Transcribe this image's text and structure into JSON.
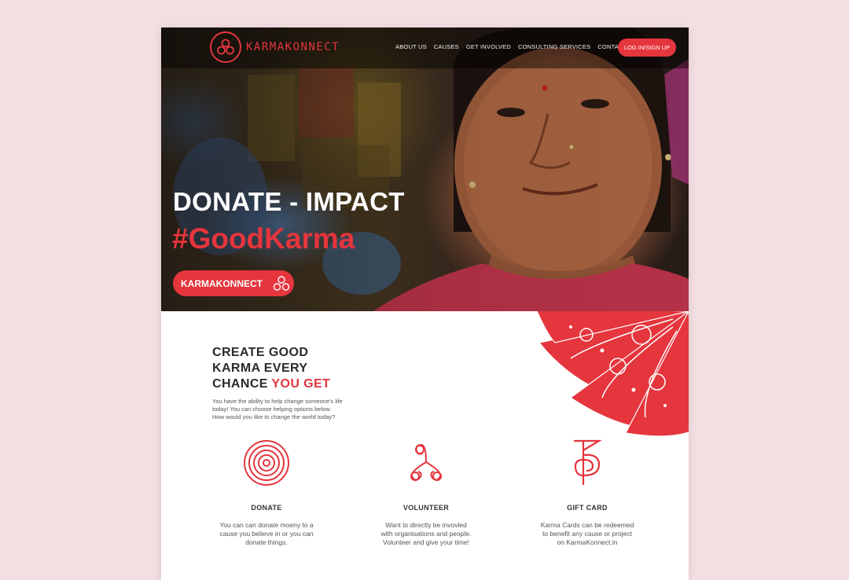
{
  "brand": {
    "name": "KARMAKONNECT",
    "accent": "#e5353d"
  },
  "nav": {
    "items": [
      "ABOUT US",
      "CAUSES",
      "GET INVOLVED",
      "CONSULTING SERVICES",
      "CONTACT"
    ],
    "login_label": "LOG IN/SIGN UP"
  },
  "hero": {
    "title": "DONATE - IMPACT",
    "tagline": "#GoodKarma",
    "cta_label": "KARMAKONNECT"
  },
  "intro": {
    "heading_line1": "CREATE GOOD",
    "heading_line2": "KARMA EVERY",
    "heading_line3_plain": "CHANCE ",
    "heading_line3_accent": "YOU GET",
    "body_line1": "You have the ability to help change someone's life",
    "body_line2": "today! You can choose helping options below.",
    "body_line3": "How would you like to change the world today?"
  },
  "features": [
    {
      "title": "DONATE",
      "icon": "spiral-icon",
      "desc_line1": "You can can donate moeny to a",
      "desc_line2": "cause you believe in or you can",
      "desc_line3": "donate things."
    },
    {
      "title": "VOLUNTEER",
      "icon": "triskelion-icon",
      "desc_line1": "Want to directly be invovled",
      "desc_line2": "with organisations and people.",
      "desc_line3": "Volunteer and give your time!"
    },
    {
      "title": "GIFT CARD",
      "icon": "cho-ku-rei-icon",
      "desc_line1": "Karma Cards can be redeemed",
      "desc_line2": "to benefit any cause or project",
      "desc_line3": "on KarmaKonnect.in"
    }
  ]
}
